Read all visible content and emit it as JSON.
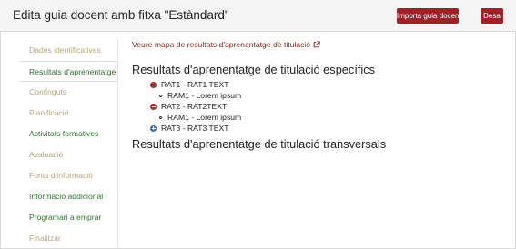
{
  "header": {
    "title": "Edita guia docent amb fitxa \"Estàndard\"",
    "import_label": "Importa guia docent",
    "save_label": "Desa"
  },
  "sidebar": {
    "items": [
      {
        "label": "Dades identificatives",
        "state": "muted"
      },
      {
        "label": "Resultats d'aprenentatge",
        "state": "active"
      },
      {
        "label": "Continguts",
        "state": "muted"
      },
      {
        "label": "Planificació",
        "state": "muted"
      },
      {
        "label": "Activitats formatives",
        "state": "link"
      },
      {
        "label": "Avaluació",
        "state": "muted"
      },
      {
        "label": "Fonts d'informació",
        "state": "muted"
      },
      {
        "label": "Informació addicional",
        "state": "link"
      },
      {
        "label": "Programari a emprar",
        "state": "link"
      },
      {
        "label": "Finalitzar",
        "state": "muted"
      }
    ]
  },
  "main": {
    "map_link": "Veure mapa de resultats d'aprenentatge de titulació",
    "specific_title": "Resultats d'aprenentatge de titulació específics",
    "results": [
      {
        "label": "RAT1 - RAT1 TEXT",
        "icon": "collapse-icon",
        "sub": "RAM1 - Lorem ipsum"
      },
      {
        "label": "RAT2 - RAT2TEXT",
        "icon": "collapse-icon",
        "sub": "RAM1 - Lorem ipsum"
      },
      {
        "label": "RAT3 - RAT3 TEXT",
        "icon": "expand-icon"
      }
    ],
    "transversal_title": "Resultats d'aprenentatge de titulació transversals"
  },
  "colors": {
    "accent": "#9b2226",
    "muted_nav": "#b5a77a",
    "link_nav": "#2c7a2a",
    "collapse": "#c7272c",
    "expand": "#2d6bd3"
  }
}
